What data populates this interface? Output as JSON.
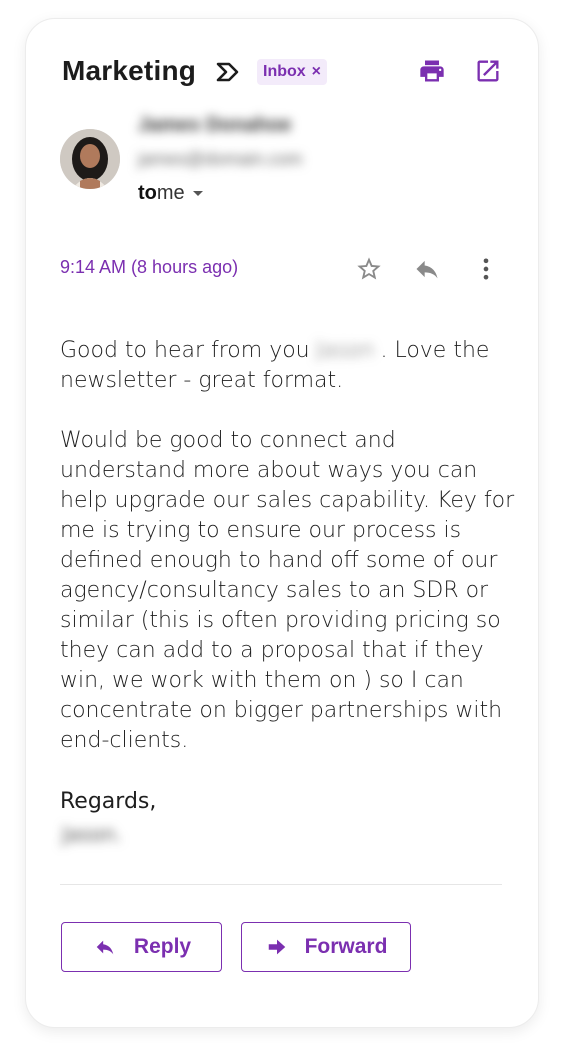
{
  "email": {
    "subject": "Marketing",
    "label_chip": "Inbox",
    "label_chip_close": "×",
    "sender_name": "James Donahoe",
    "sender_email": "james@domain.com",
    "to_prefix": "to",
    "to_value": "me",
    "time": "9:14 AM (8 hours ago)",
    "body": {
      "p1_before": "Good to hear from you",
      "p1_name": "Jason",
      "p1_after": ". Love the newsletter - great format.",
      "p2": "Would be good to connect and understand more about ways you can help upgrade our sales capability. Key for me is trying to ensure our process is defined enough to hand off some of our agency/consultancy sales to an SDR or similar (this is often providing pricing so they can add to a proposal that if they win, we work with them on ) so I can concentrate on bigger partnerships with end-clients."
    },
    "regards": "Regards,",
    "signature": "Jason."
  },
  "actions": {
    "reply_label": "Reply",
    "forward_label": "Forward"
  },
  "icons": {
    "label": "label-outline-icon",
    "print": "print-icon",
    "open_new": "open-in-new-icon",
    "star": "star-outline-icon",
    "reply": "reply-icon",
    "more": "more-vert-icon",
    "forward": "forward-arrow-icon"
  },
  "colors": {
    "accent": "#7b2fb0",
    "chip_bg": "#f3ebfa",
    "muted_icon": "#8a8a8a"
  }
}
